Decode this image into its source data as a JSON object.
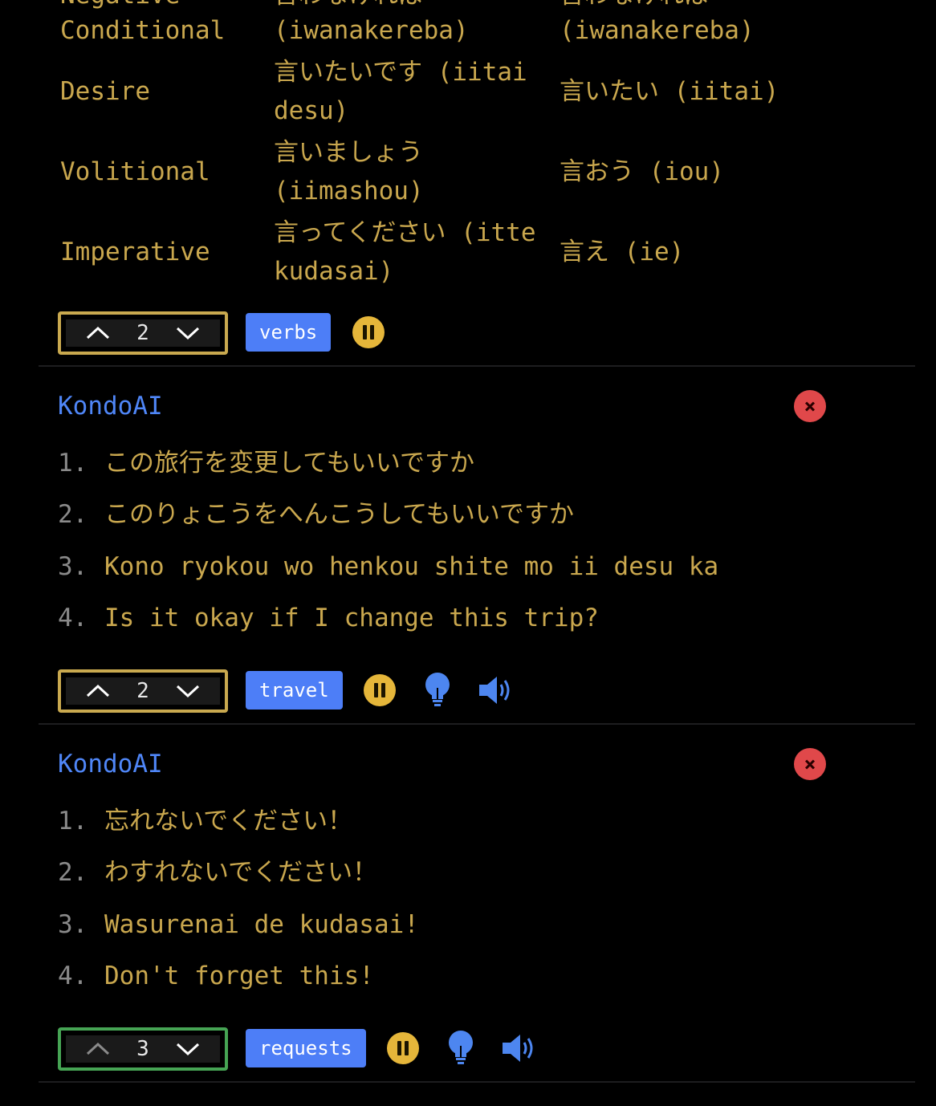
{
  "conjugation_table": {
    "rows": [
      {
        "form": "Conditional",
        "polite": "(iwanakereba)",
        "plain": "(iwanakereba)"
      },
      {
        "form": "Desire",
        "polite_line1": "言いたいです (iitai",
        "polite_line2": "desu)",
        "plain": "言いたい (iitai)"
      },
      {
        "form": "Volitional",
        "polite_line1": "言いましょう",
        "polite_line2": "(iimashou)",
        "plain": "言おう (iou)"
      },
      {
        "form": "Imperative",
        "polite_line1": "言ってください (itte",
        "polite_line2": "kudasai)",
        "plain": "言え (ie)"
      }
    ]
  },
  "cards": [
    {
      "count": "2",
      "tag": "verbs"
    },
    {
      "author": "KondoAI",
      "lines": [
        {
          "num": "1.",
          "text": "この旅行を変更してもいいですか"
        },
        {
          "num": "2.",
          "text": "このりょこうをへんこうしてもいいですか"
        },
        {
          "num": "3.",
          "text": "Kono ryokou wo henkou shite mo ii desu ka"
        },
        {
          "num": "4.",
          "text": "Is it okay if I change this trip?"
        }
      ],
      "count": "2",
      "tag": "travel"
    },
    {
      "author": "KondoAI",
      "lines": [
        {
          "num": "1.",
          "text": "忘れないでください！"
        },
        {
          "num": "2.",
          "text": "わすれないでください！"
        },
        {
          "num": "3.",
          "text": "Wasurenai de kudasai!"
        },
        {
          "num": "4.",
          "text": "Don't forget this!"
        }
      ],
      "count": "3",
      "tag": "requests"
    }
  ],
  "icons": {
    "pause": "pause-icon",
    "hint": "lightbulb-icon",
    "audio": "speaker-icon",
    "delete": "close-icon"
  },
  "colors": {
    "text_gold": "#c9a74e",
    "accent_blue": "#4d7ef7",
    "delete_red": "#e0484a",
    "pause_yellow": "#e5b63a",
    "stepper_gold": "#c9a94f",
    "stepper_green": "#46a454"
  }
}
